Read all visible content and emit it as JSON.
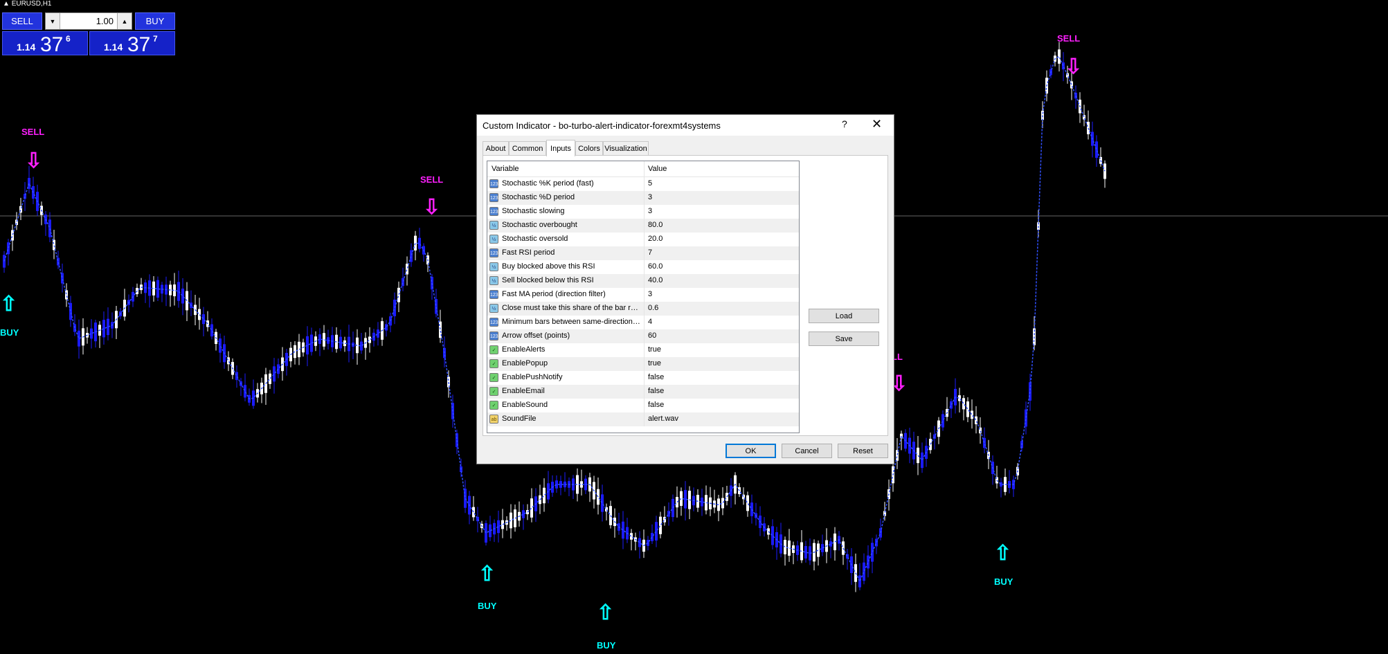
{
  "chart": {
    "symbol": "EURUSD,H1",
    "signals": [
      {
        "type": "sell",
        "label": "SELL"
      },
      {
        "type": "buy",
        "label": "BUY"
      },
      {
        "type": "sell",
        "label": "SELL"
      },
      {
        "type": "buy",
        "label": "BUY"
      },
      {
        "type": "buy",
        "label": "BUY"
      },
      {
        "type": "sell",
        "label": "LL"
      },
      {
        "type": "buy",
        "label": "BUY"
      },
      {
        "type": "sell",
        "label": "SELL"
      }
    ]
  },
  "trade_panel": {
    "sell_label": "SELL",
    "buy_label": "BUY",
    "lot": "1.00",
    "bid": {
      "small": "1.14",
      "big": "37",
      "sup": "6"
    },
    "ask": {
      "small": "1.14",
      "big": "37",
      "sup": "7"
    }
  },
  "dialog": {
    "title": "Custom Indicator - bo-turbo-alert-indicator-forexmt4systems",
    "help": "?",
    "close": "✕",
    "tabs": [
      "About",
      "Common",
      "Inputs",
      "Colors",
      "Visualization"
    ],
    "active_tab": "Inputs",
    "columns": {
      "variable": "Variable",
      "value": "Value"
    },
    "rows": [
      {
        "icon": "int",
        "name": "Stochastic %K period (fast)",
        "value": "5"
      },
      {
        "icon": "int",
        "name": "Stochastic %D period",
        "value": "3"
      },
      {
        "icon": "int",
        "name": "Stochastic slowing",
        "value": "3"
      },
      {
        "icon": "dbl",
        "name": "Stochastic overbought",
        "value": "80.0"
      },
      {
        "icon": "dbl",
        "name": "Stochastic oversold",
        "value": "20.0"
      },
      {
        "icon": "int",
        "name": "Fast RSI period",
        "value": "7"
      },
      {
        "icon": "dbl",
        "name": "Buy blocked above this RSI",
        "value": "60.0"
      },
      {
        "icon": "dbl",
        "name": "Sell blocked below this RSI",
        "value": "40.0"
      },
      {
        "icon": "int",
        "name": "Fast MA period (direction filter)",
        "value": "3"
      },
      {
        "icon": "dbl",
        "name": "Close must take this share of the bar range",
        "value": "0.6"
      },
      {
        "icon": "int",
        "name": "Minimum bars between same-direction ar...",
        "value": "4"
      },
      {
        "icon": "int",
        "name": "Arrow offset (points)",
        "value": "60"
      },
      {
        "icon": "bool",
        "name": "EnableAlerts",
        "value": "true"
      },
      {
        "icon": "bool",
        "name": "EnablePopup",
        "value": "true"
      },
      {
        "icon": "bool",
        "name": "EnablePushNotify",
        "value": "false"
      },
      {
        "icon": "bool",
        "name": "EnableEmail",
        "value": "false"
      },
      {
        "icon": "bool",
        "name": "EnableSound",
        "value": "false"
      },
      {
        "icon": "str",
        "name": "SoundFile",
        "value": "alert.wav"
      }
    ],
    "icon_text": {
      "int": "123",
      "dbl": "½",
      "bool": "✓",
      "str": "ab"
    },
    "buttons": {
      "load": "Load",
      "save": "Save",
      "ok": "OK",
      "cancel": "Cancel",
      "reset": "Reset"
    }
  },
  "colors": {
    "bull": "#ffffff",
    "bear": "#1b1bff",
    "sell_signal": "#ff1fff",
    "buy_signal": "#00ffff",
    "line": "#3050ff"
  }
}
